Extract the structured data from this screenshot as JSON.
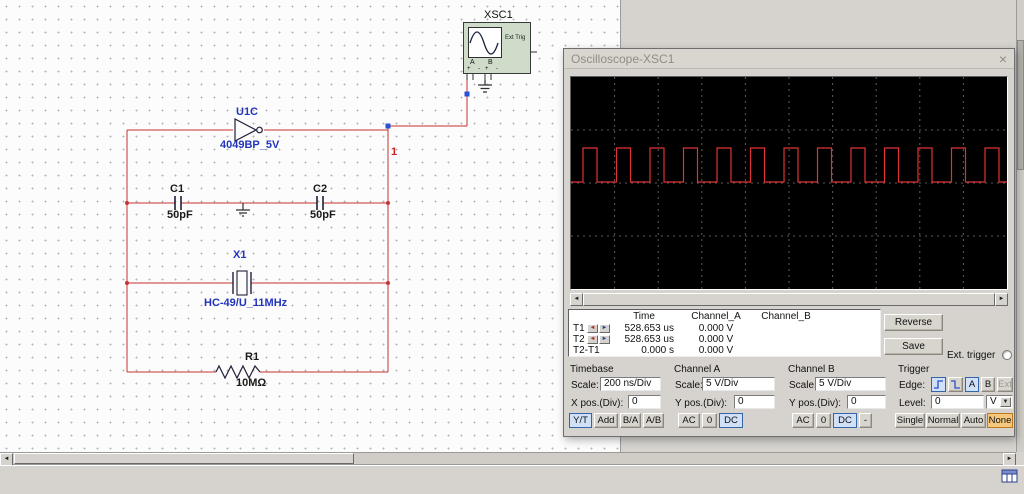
{
  "canvas": {
    "instrument_icon": {
      "label": "XSC1",
      "ext_trig": "Ext Trig",
      "a": "A",
      "b": "B",
      "pm": "+ -"
    },
    "components": {
      "u1": {
        "ref": "U1C",
        "value": "4049BP_5V"
      },
      "c1": {
        "ref": "C1",
        "value": "50pF"
      },
      "c2": {
        "ref": "C2",
        "value": "50pF"
      },
      "x1": {
        "ref": "X1",
        "value": "HC-49/U_11MHz"
      },
      "r1": {
        "ref": "R1",
        "value": "10MΩ"
      }
    },
    "net_label": "1"
  },
  "scope": {
    "title": "Oscilloscope-XSC1",
    "close_glyph": "×",
    "measurements": {
      "col_headers": {
        "time": "Time",
        "channel_a": "Channel_A",
        "channel_b": "Channel_B"
      },
      "rows": [
        {
          "label": "T1",
          "time": "528.653 us",
          "channel_a": "0.000 V"
        },
        {
          "label": "T2",
          "time": "528.653 us",
          "channel_a": "0.000 V"
        },
        {
          "label": "T2-T1",
          "time": "0.000 s",
          "channel_a": "0.000 V"
        }
      ],
      "arrow_left": "◄",
      "arrow_right": "►"
    },
    "side_buttons": {
      "reverse": "Reverse",
      "save": "Save"
    },
    "ext_trigger_label": "Ext. trigger",
    "timebase": {
      "title": "Timebase",
      "scale_label": "Scale:",
      "scale_value": "200 ns/Div",
      "pos_label": "X pos.(Div):",
      "pos_value": "0",
      "btn_yt": "Y/T",
      "btn_add": "Add",
      "btn_ba": "B/A",
      "btn_ab": "A/B"
    },
    "channel_a": {
      "title": "Channel A",
      "scale_label": "Scale:",
      "scale_value": "5  V/Div",
      "pos_label": "Y pos.(Div):",
      "pos_value": "0",
      "btn_ac": "AC",
      "btn_0": "0",
      "btn_dc": "DC"
    },
    "channel_b": {
      "title": "Channel B",
      "scale_label": "Scale:",
      "scale_value": "5  V/Div",
      "pos_label": "Y pos.(Div):",
      "pos_value": "0",
      "btn_ac": "AC",
      "btn_0": "0",
      "btn_dc": "DC",
      "btn_inv": "-"
    },
    "trigger": {
      "title": "Trigger",
      "edge_label": "Edge:",
      "btn_a": "A",
      "btn_b": "B",
      "btn_ext": "Ext",
      "level_label": "Level:",
      "level_value": "0",
      "level_unit": "V",
      "btn_single": "Single",
      "btn_normal": "Normal",
      "btn_auto": "Auto",
      "btn_none": "None"
    },
    "sb_left": "◄",
    "sb_right": "►",
    "combo_arrow": "▼"
  },
  "chart_data": {
    "type": "line",
    "title": "Oscilloscope trace - Channel A square wave",
    "series": [
      {
        "name": "Channel_A",
        "shape": "square-wave",
        "timebase": "200 ns/Div",
        "scale": "5 V/Div",
        "approx_period_divisions": 0.77,
        "approx_amplitude_divisions": 0.65,
        "duty_cycle": 0.42
      }
    ],
    "grid": {
      "columns": 10,
      "rows": 4
    },
    "render": {
      "y_high": 71,
      "y_low": 105,
      "period": 33.5,
      "high_width": 14,
      "first_rise_x": 12,
      "trace_color": "#e03232",
      "grid_color": "#5c5c5c"
    }
  }
}
